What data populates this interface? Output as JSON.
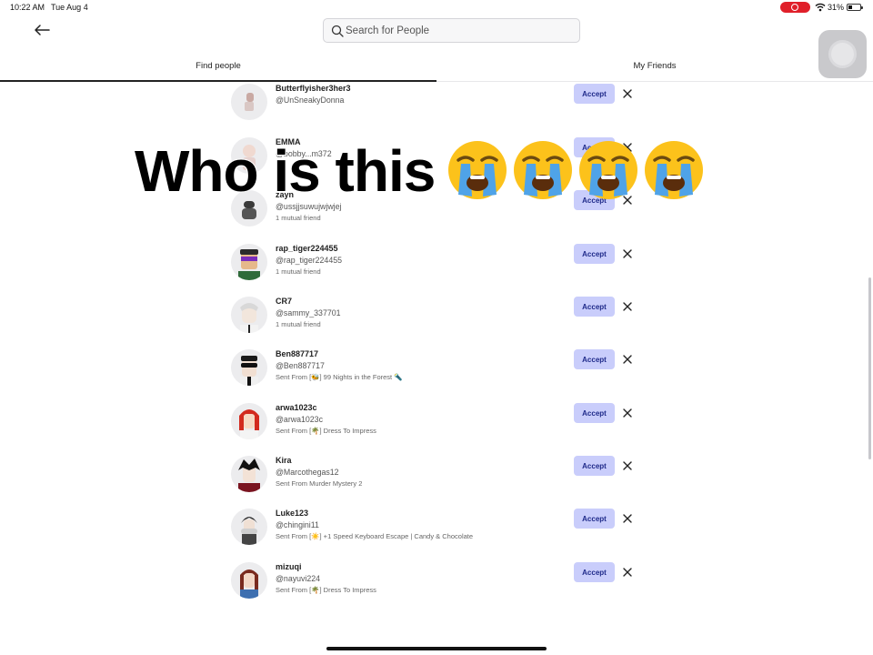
{
  "status_bar": {
    "time": "10:22 AM",
    "date": "Tue Aug 4",
    "battery": "31%"
  },
  "header": {
    "search_placeholder": "Search for People"
  },
  "tabs": [
    {
      "label": "Find people",
      "active": true
    },
    {
      "label": "My Friends",
      "active": false
    }
  ],
  "requests": [
    {
      "name": "Butterflyisher3her3",
      "handle": "@UnSneakyDonna",
      "sub": ""
    },
    {
      "name": "EMMA",
      "handle": "@bobby...m372",
      "sub": ""
    },
    {
      "name": "zayn",
      "handle": "@ussjjsuwujwjwjej",
      "sub": "1 mutual friend"
    },
    {
      "name": "rap_tiger224455",
      "handle": "@rap_tiger224455",
      "sub": "1 mutual friend"
    },
    {
      "name": "CR7",
      "handle": "@sammy_337701",
      "sub": "1 mutual friend"
    },
    {
      "name": "Ben887717",
      "handle": "@Ben887717",
      "sub": "Sent From [🐝] 99 Nights in the Forest 🔦"
    },
    {
      "name": "arwa1023c",
      "handle": "@arwa1023c",
      "sub": "Sent From [🌴] Dress To Impress"
    },
    {
      "name": "Kira",
      "handle": "@Marcothegas12",
      "sub": "Sent From Murder Mystery 2"
    },
    {
      "name": "Luke123",
      "handle": "@chingini11",
      "sub": "Sent From  [☀️] +1 Speed Keyboard Escape | Candy & Chocolate"
    },
    {
      "name": "mizuqi",
      "handle": "@nayuvi224",
      "sub": "Sent From [🌴] Dress To Impress"
    }
  ],
  "buttons": {
    "accept_label": "Accept"
  },
  "overlay": {
    "caption": "Who is this",
    "emoji_count": 4
  },
  "colors": {
    "accept_bg": "#c9cdfb",
    "accept_text": "#1f2a8a",
    "record": "#e0202a"
  }
}
